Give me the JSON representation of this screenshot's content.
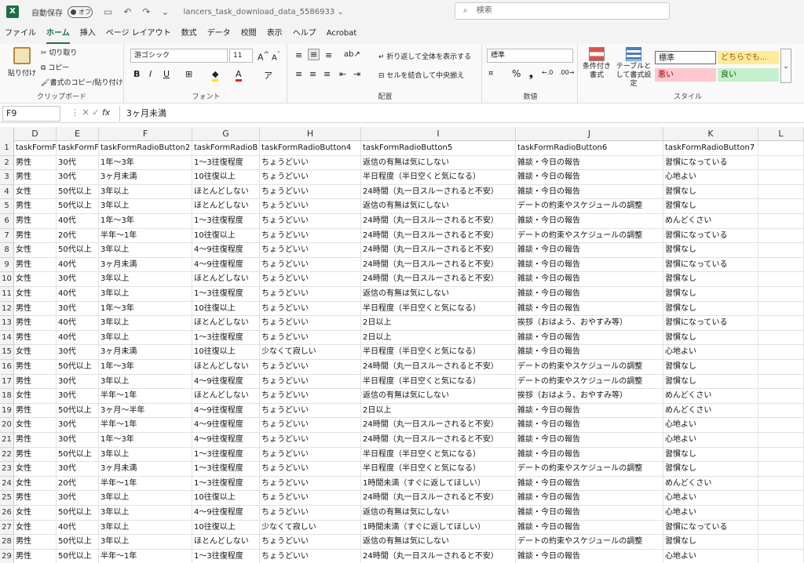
{
  "titlebar": {
    "autosave_label": "自動保存",
    "toggle_state": "オフ",
    "filename": "lancers_task_download_data_5586933 ⌄",
    "search_placeholder": "検索"
  },
  "menu": [
    "ファイル",
    "ホーム",
    "挿入",
    "ページ レイアウト",
    "数式",
    "データ",
    "校閲",
    "表示",
    "ヘルプ",
    "Acrobat"
  ],
  "ribbon": {
    "clipboard": {
      "paste": "貼り付け",
      "cut": "切り取り",
      "copy": "コピー",
      "format_painter": "書式のコピー/貼り付け",
      "label": "クリップボード"
    },
    "font": {
      "name": "游ゴシック",
      "size": "11",
      "label": "フォント"
    },
    "alignment": {
      "wrap": "折り返して全体を表示する",
      "merge": "セルを結合して中央揃え",
      "label": "配置"
    },
    "number": {
      "format": "標準",
      "label": "数値"
    },
    "styles": {
      "conditional": "条件付き書式",
      "table": "テーブルとして書式設定",
      "normal": "標準",
      "neutral": "どちらでも...",
      "bad": "悪い",
      "good": "良い",
      "label": "スタイル"
    }
  },
  "formula": {
    "namebox": "F9",
    "value": "3ヶ月未満"
  },
  "columns": [
    "D",
    "E",
    "F",
    "G",
    "H",
    "I",
    "J",
    "K",
    "L"
  ],
  "rows": [
    [
      "1",
      "taskFormF",
      "taskFormF",
      "taskFormRadioButton2",
      "taskFormRadioB",
      "taskFormRadioButton4",
      "taskFormRadioButton5",
      "taskFormRadioButton6",
      "taskFormRadioButton7"
    ],
    [
      "2",
      "男性",
      "30代",
      "1年～3年",
      "1～3往復程度",
      "ちょうどいい",
      "返信の有無は気にしない",
      "雑談・今日の報告",
      "習慣になっている"
    ],
    [
      "3",
      "男性",
      "30代",
      "3ヶ月未満",
      "10往復以上",
      "ちょうどいい",
      "半日程度（半日空くと気になる）",
      "雑談・今日の報告",
      "心地よい"
    ],
    [
      "4",
      "女性",
      "50代以上",
      "3年以上",
      "ほとんどしない",
      "ちょうどいい",
      "24時間（丸一日スルーされると不安）",
      "雑談・今日の報告",
      "習慣なし"
    ],
    [
      "5",
      "男性",
      "50代以上",
      "3年以上",
      "ほとんどしない",
      "ちょうどいい",
      "返信の有無は気にしない",
      "デートの約束やスケジュールの調整",
      "習慣なし"
    ],
    [
      "6",
      "男性",
      "40代",
      "1年～3年",
      "1～3往復程度",
      "ちょうどいい",
      "24時間（丸一日スルーされると不安）",
      "雑談・今日の報告",
      "めんどくさい"
    ],
    [
      "7",
      "男性",
      "20代",
      "半年～1年",
      "10往復以上",
      "ちょうどいい",
      "24時間（丸一日スルーされると不安）",
      "デートの約束やスケジュールの調整",
      "習慣になっている"
    ],
    [
      "8",
      "女性",
      "50代以上",
      "3年以上",
      "4～9往復程度",
      "ちょうどいい",
      "24時間（丸一日スルーされると不安）",
      "雑談・今日の報告",
      "習慣なし"
    ],
    [
      "9",
      "男性",
      "40代",
      "3ヶ月未満",
      "4～9往復程度",
      "ちょうどいい",
      "24時間（丸一日スルーされると不安）",
      "雑談・今日の報告",
      "習慣になっている"
    ],
    [
      "10",
      "女性",
      "30代",
      "3年以上",
      "ほとんどしない",
      "ちょうどいい",
      "24時間（丸一日スルーされると不安）",
      "雑談・今日の報告",
      "習慣なし"
    ],
    [
      "11",
      "女性",
      "40代",
      "3年以上",
      "1～3往復程度",
      "ちょうどいい",
      "返信の有無は気にしない",
      "雑談・今日の報告",
      "習慣なし"
    ],
    [
      "12",
      "男性",
      "30代",
      "1年～3年",
      "10往復以上",
      "ちょうどいい",
      "半日程度（半日空くと気になる）",
      "雑談・今日の報告",
      "習慣なし"
    ],
    [
      "13",
      "男性",
      "40代",
      "3年以上",
      "ほとんどしない",
      "ちょうどいい",
      "2日以上",
      "挨拶（おはよう、おやすみ等）",
      "習慣になっている"
    ],
    [
      "14",
      "男性",
      "40代",
      "3年以上",
      "1～3往復程度",
      "ちょうどいい",
      "2日以上",
      "雑談・今日の報告",
      "習慣なし"
    ],
    [
      "15",
      "女性",
      "30代",
      "3ヶ月未満",
      "10往復以上",
      "少なくて寂しい",
      "半日程度（半日空くと気になる）",
      "雑談・今日の報告",
      "心地よい"
    ],
    [
      "16",
      "男性",
      "50代以上",
      "1年～3年",
      "ほとんどしない",
      "ちょうどいい",
      "24時間（丸一日スルーされると不安）",
      "デートの約束やスケジュールの調整",
      "習慣なし"
    ],
    [
      "17",
      "男性",
      "30代",
      "3年以上",
      "4～9往復程度",
      "ちょうどいい",
      "半日程度（半日空くと気になる）",
      "デートの約束やスケジュールの調整",
      "習慣なし"
    ],
    [
      "18",
      "女性",
      "30代",
      "半年～1年",
      "ほとんどしない",
      "ちょうどいい",
      "返信の有無は気にしない",
      "挨拶（おはよう、おやすみ等）",
      "めんどくさい"
    ],
    [
      "19",
      "男性",
      "50代以上",
      "3ヶ月～半年",
      "4～9往復程度",
      "ちょうどいい",
      "2日以上",
      "雑談・今日の報告",
      "めんどくさい"
    ],
    [
      "20",
      "女性",
      "30代",
      "半年～1年",
      "4～9往復程度",
      "ちょうどいい",
      "24時間（丸一日スルーされると不安）",
      "雑談・今日の報告",
      "心地よい"
    ],
    [
      "21",
      "男性",
      "30代",
      "1年～3年",
      "4～9往復程度",
      "ちょうどいい",
      "24時間（丸一日スルーされると不安）",
      "雑談・今日の報告",
      "心地よい"
    ],
    [
      "22",
      "男性",
      "50代以上",
      "3年以上",
      "1～3往復程度",
      "ちょうどいい",
      "半日程度（半日空くと気になる）",
      "雑談・今日の報告",
      "習慣なし"
    ],
    [
      "23",
      "女性",
      "30代",
      "3ヶ月未満",
      "1～3往復程度",
      "ちょうどいい",
      "半日程度（半日空くと気になる）",
      "デートの約束やスケジュールの調整",
      "習慣なし"
    ],
    [
      "24",
      "女性",
      "20代",
      "半年～1年",
      "1～3往復程度",
      "ちょうどいい",
      "1時間未満（すぐに返してほしい）",
      "雑談・今日の報告",
      "めんどくさい"
    ],
    [
      "25",
      "男性",
      "30代",
      "3年以上",
      "10往復以上",
      "ちょうどいい",
      "24時間（丸一日スルーされると不安）",
      "雑談・今日の報告",
      "心地よい"
    ],
    [
      "26",
      "女性",
      "50代以上",
      "3年以上",
      "4～9往復程度",
      "ちょうどいい",
      "返信の有無は気にしない",
      "雑談・今日の報告",
      "心地よい"
    ],
    [
      "27",
      "女性",
      "40代",
      "3年以上",
      "10往復以上",
      "少なくて寂しい",
      "1時間未満（すぐに返してほしい）",
      "雑談・今日の報告",
      "習慣になっている"
    ],
    [
      "28",
      "男性",
      "50代以上",
      "3年以上",
      "ほとんどしない",
      "ちょうどいい",
      "返信の有無は気にしない",
      "デートの約束やスケジュールの調整",
      "習慣なし"
    ],
    [
      "29",
      "男性",
      "50代以上",
      "半年～1年",
      "1～3往復程度",
      "ちょうどいい",
      "24時間（丸一日スルーされると不安）",
      "雑談・今日の報告",
      "心地よい"
    ]
  ]
}
